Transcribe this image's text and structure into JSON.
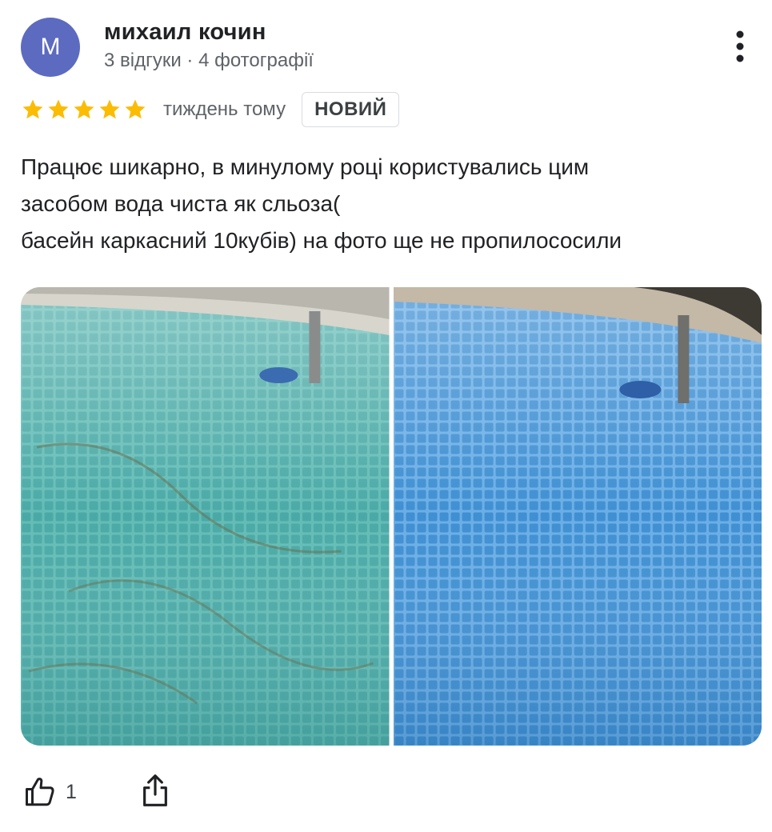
{
  "review": {
    "avatar_letter": "М",
    "avatar_color": "#5c6bc0",
    "author": "михаил кочин",
    "meta": "3 відгуки · 4 фотографії",
    "rating": 5,
    "star_color": "#fbbc04",
    "time": "тиждень тому",
    "badge": "НОВИЙ",
    "text_lines": [
      "Працює шикарно, в минулому році користувались цим",
      "засобом вода чиста як сльоза(",
      "басейн каркасний 10кубів) на фото ще не пропилососили"
    ],
    "photos": [
      {
        "name": "pool-before-photo",
        "color": "#5fb8b4"
      },
      {
        "name": "pool-after-photo",
        "color": "#3b8fd0"
      }
    ]
  },
  "actions": {
    "like_icon": "thumb-up-icon",
    "like_count": "1",
    "share_icon": "share-icon",
    "more_icon": "more-vert-icon"
  }
}
